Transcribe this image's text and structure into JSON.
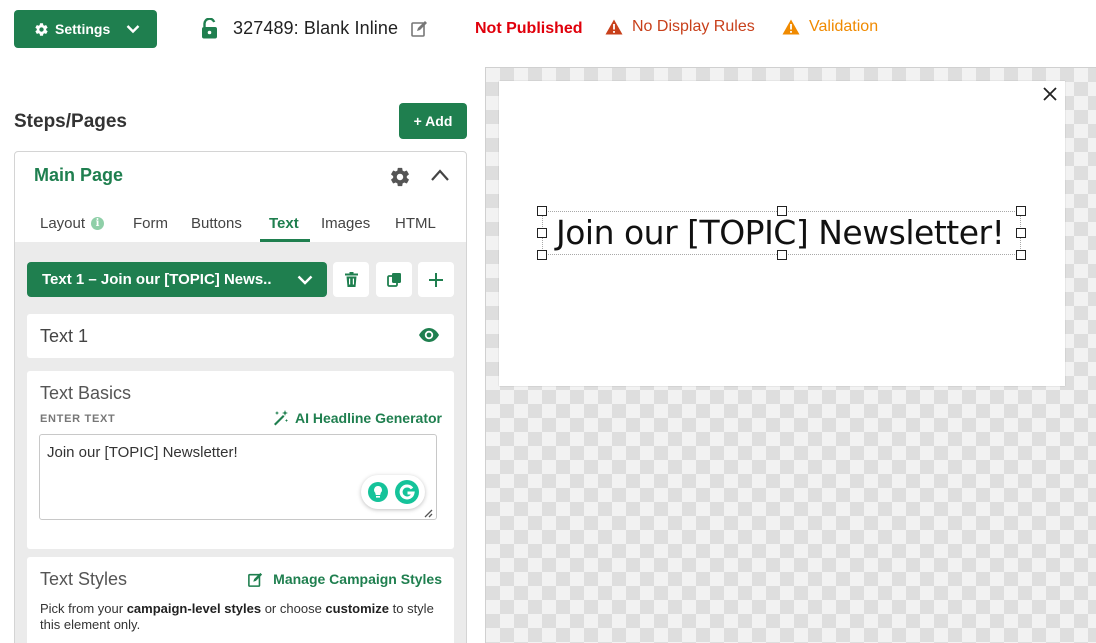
{
  "topbar": {
    "settings_label": "Settings",
    "campaign_title": "327489: Blank Inline",
    "status": "Not Published",
    "warnings": [
      "No Display Rules",
      "Validation"
    ],
    "colors": {
      "brand": "#1f7f4f",
      "not_published": "#e0000b",
      "warn_red": "#c8401b",
      "warn_orange": "#f08a00"
    }
  },
  "sidebar": {
    "title": "Steps/Pages",
    "add_label": "+ Add",
    "page": {
      "title": "Main Page",
      "tabs": [
        "Layout",
        "Form",
        "Buttons",
        "Text",
        "Images",
        "HTML"
      ],
      "active_tab": "Text"
    },
    "element_select": "Text 1 – Join our [TOPIC] News..",
    "element_name": "Text 1",
    "text_basics": {
      "heading": "Text Basics",
      "enter_text_label": "ENTER TEXT",
      "ai_link": "AI Headline Generator",
      "value": "Join our [TOPIC] Newsletter!"
    },
    "text_styles": {
      "heading": "Text Styles",
      "manage_link": "Manage Campaign Styles",
      "desc_pre": "Pick from your ",
      "desc_b1": "campaign-level styles",
      "desc_mid": " or choose ",
      "desc_b2": "customize",
      "desc_post": " to style this element only."
    }
  },
  "canvas": {
    "headline": "Join our [TOPIC] Newsletter!"
  }
}
